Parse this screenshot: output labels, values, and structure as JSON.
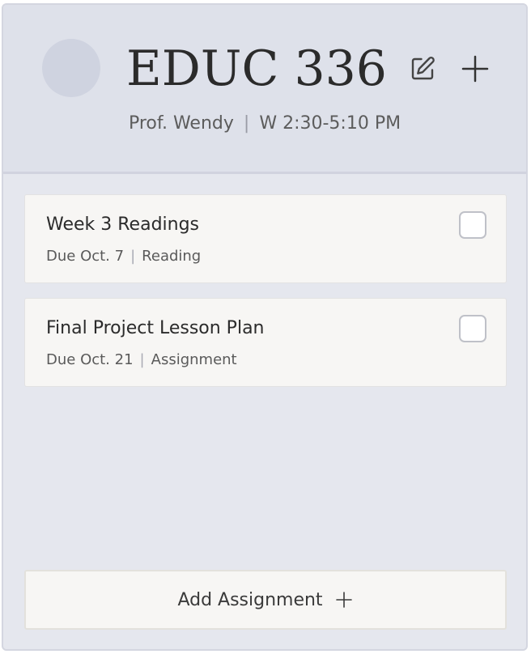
{
  "course": {
    "title": "EDUC 336",
    "professor": "Prof. Wendy",
    "schedule": "W 2:30-5:10 PM",
    "separator": "|"
  },
  "header_icons": {
    "edit": "pencil-square-icon",
    "add": "plus-icon"
  },
  "assignments": [
    {
      "title": "Week 3 Readings",
      "due": "Due Oct. 7",
      "type": "Reading",
      "separator": "|",
      "completed": false
    },
    {
      "title": "Final Project Lesson Plan",
      "due": "Due Oct. 21",
      "type": "Assignment",
      "separator": "|",
      "completed": false
    }
  ],
  "add_assignment": {
    "label": "Add Assignment",
    "icon": "plus-icon"
  },
  "colors": {
    "card_background": "#e5e7ee",
    "header_background": "#dee1ea",
    "avatar": "#cfd3e0",
    "item_background": "#f7f6f4",
    "text": "#2b2b2b"
  }
}
